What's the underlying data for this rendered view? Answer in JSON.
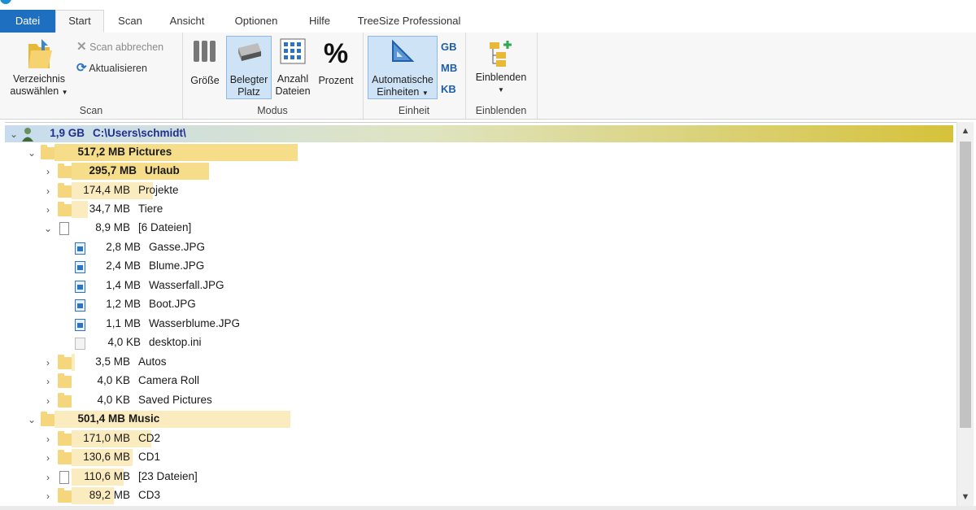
{
  "tabs": [
    "Datei",
    "Start",
    "Scan",
    "Ansicht",
    "Optionen",
    "Hilfe",
    "TreeSize Professional"
  ],
  "ribbon": {
    "scan": {
      "choose_dir": "Verzeichnis",
      "choose_dir_2": "auswählen",
      "abort": "Scan abbrechen",
      "refresh": "Aktualisieren",
      "label": "Scan"
    },
    "mode": {
      "size": "Größe",
      "used": "Belegter",
      "used_2": "Platz",
      "count": "Anzahl",
      "count_2": "Dateien",
      "percent": "Prozent",
      "percent_icon": "%",
      "label": "Modus"
    },
    "unit": {
      "auto": "Automatische",
      "auto_2": "Einheiten",
      "gb": "GB",
      "mb": "MB",
      "kb": "KB",
      "label": "Einheit"
    },
    "show": {
      "button": "Einblenden",
      "label": "Einblenden"
    }
  },
  "tree": {
    "root": {
      "size": "1,9 GB",
      "name": "C:\\Users\\schmidt\\"
    },
    "rows": [
      {
        "size": "517,2 MB",
        "name": "Pictures",
        "bold": true
      },
      {
        "size": "295,7 MB",
        "name": "Urlaub",
        "bold": true
      },
      {
        "size": "174,4 MB",
        "name": "Projekte"
      },
      {
        "size": "34,7 MB",
        "name": "Tiere"
      },
      {
        "size": "8,9 MB",
        "name": "[6 Dateien]"
      },
      {
        "size": "2,8 MB",
        "name": "Gasse.JPG"
      },
      {
        "size": "2,4 MB",
        "name": "Blume.JPG"
      },
      {
        "size": "1,4 MB",
        "name": "Wasserfall.JPG"
      },
      {
        "size": "1,2 MB",
        "name": "Boot.JPG"
      },
      {
        "size": "1,1 MB",
        "name": "Wasserblume.JPG"
      },
      {
        "size": "4,0 KB",
        "name": "desktop.ini"
      },
      {
        "size": "3,5 MB",
        "name": "Autos"
      },
      {
        "size": "4,0 KB",
        "name": "Camera Roll"
      },
      {
        "size": "4,0 KB",
        "name": "Saved Pictures"
      },
      {
        "size": "501,4 MB",
        "name": "Music",
        "bold": true
      },
      {
        "size": "171,0 MB",
        "name": "CD2"
      },
      {
        "size": "130,6 MB",
        "name": "CD1"
      },
      {
        "size": "110,6 MB",
        "name": "[23 Dateien]"
      },
      {
        "size": "89,2 MB",
        "name": "CD3"
      }
    ]
  },
  "icons": {
    "expand": "chevron-right-icon",
    "collapse": "chevron-down-icon",
    "folder": "folder-icon",
    "files": "document-icon",
    "image": "image-file-icon",
    "ini": "settings-file-icon",
    "user": "user-icon"
  },
  "colors": {
    "file_tab": "#1f6fc0",
    "bar_strong": "#f6dd8a",
    "bar_light": "#fbecc0",
    "root_gradient_start": "#c7dcef",
    "root_gradient_end": "#d6c23a",
    "root_text": "#1f2f8f",
    "selected_button": "#cfe3f7"
  }
}
